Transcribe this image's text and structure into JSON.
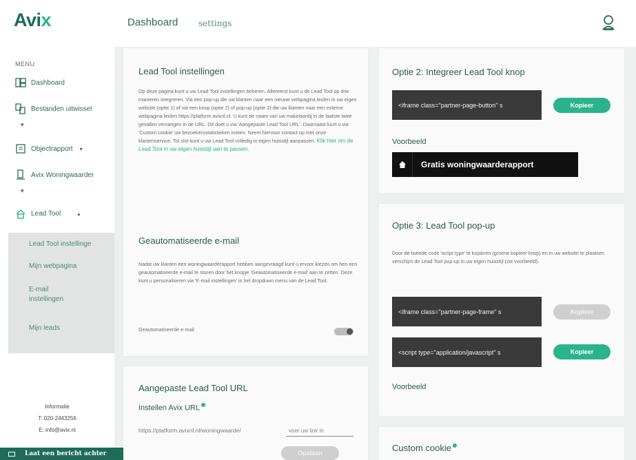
{
  "header": {
    "logo_main": "Avi",
    "logo_x": "x",
    "nav_dashboard": "Dashboard",
    "nav_settings": "settings",
    "user_icon": "user-icon"
  },
  "sidebar": {
    "menu_title": "MENU",
    "items": [
      {
        "label": "Dashboard",
        "icon": "dashboard-icon"
      },
      {
        "label": "Bestanden uitwissel",
        "icon": "files-icon"
      },
      {
        "label": "Objectrapport",
        "icon": "report-icon",
        "caret": "▾"
      },
      {
        "label": "Avix Woningwaarder",
        "icon": "house-value-icon"
      },
      {
        "label": "Lead Tool",
        "icon": "lead-tool-icon",
        "caret": "▴"
      }
    ],
    "dots": [
      "▾",
      "▾"
    ],
    "submenu": [
      "Lead Tool instellinge",
      "Mijn webpagina",
      "E-mail instellingen",
      "Mijn leads"
    ],
    "info_title": "Informatie",
    "info_phone": "T: 020-2443256",
    "info_email": "E: info@avix.nl",
    "message_bar": "Laat een bericht achter"
  },
  "lead_settings": {
    "title": "Lead Tool instellingen",
    "paragraph": "Op deze pagina kunt u uw Lead Tool instellingen beheren. Allereerst kunt u de Lead Tool op drie manieren integreren. Via een pop-up die uw klanten naar een nieuwe webpagina leiden in uw eigen website (optie 1) of via een knop (optie 2) of pop-up (optie 3) die uw klanten naar een externe webpagina leiden https://platform.avixnl.nl. U kunt de naam van uw makelaardij in de laatste twee gevallen vervangen in de URL. Dit doet u via 'Aangepaste Lead Tool URL'. Daarnaast kunt u via 'Custom cookie' uw bezoekersstatistieken meten. Neem hiervoor contact op met onze klantenservice. Tot slot kunt u uw Lead Tool volledig in eigen huisstijl aanpassen.",
    "link": "Klik hier om de Lead Tool in uw eigen huisstijl aan te passen."
  },
  "auto_email": {
    "title": "Geautomatiseerde e-mail",
    "paragraph": "Nadat uw klanten een woningwaarderapport hebben aangevraagd kunt u ervoor kiezen om hen een geautomatiseerde e-mail te sturen door het knopje 'Geautomatiseerde e-mail' aan te zetten. Deze kunt u personaliseren via 'E-mail instellingen' in het dropdown menu van de Lead Tool.",
    "toggle_label": "Geautomatiseerde e-mail"
  },
  "custom_url": {
    "title": "Aangepaste Lead Tool URL",
    "subtitle": "Instellen Avix URL",
    "prefix": "https://platform.avixnl.nl/woningwaarde/",
    "placeholder": "voer uw link in",
    "button": "Opslaan"
  },
  "option2": {
    "title": "Optie 2: Integreer Lead Tool knop",
    "code": "<iframe class=\"partner-page-button\" s",
    "copy_button": "Kopieer",
    "preview_label": "Voorbeeld",
    "demo_label": "Gratis woningwaarderapport"
  },
  "option3": {
    "title": "Optie 3: Lead Tool pop-up",
    "paragraph": "Door de tweede code 'script type' te kopieren (groene kopieer knop) en in uw website te plaatsen verschijnt de Lead Tool pop-up in uw eigen huisstijl (zie voorbeeld).",
    "code1": "<iframe class=\"partner-page-frame\" s",
    "copy1": "Kopieer",
    "code2": "<script type=\"application/javascript\" s",
    "copy2": "Kopieer",
    "preview_label": "Voorbeeld"
  },
  "cookie": {
    "title": "Custom cookie"
  },
  "colors": {
    "brand_green": "#2bb48c",
    "dark_green": "#1f6b57",
    "code_bg": "#3a3a3a"
  }
}
